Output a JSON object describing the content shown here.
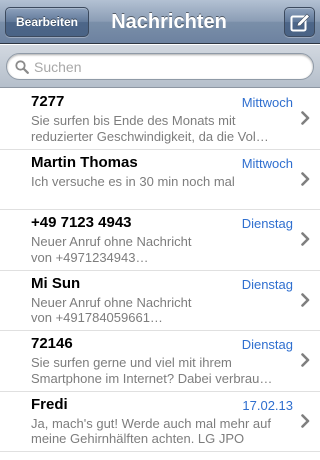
{
  "navbar": {
    "title": "Nachrichten",
    "edit_label": "Bearbeiten",
    "compose_icon": "compose-icon"
  },
  "search": {
    "placeholder": "Suchen",
    "icon": "search-icon"
  },
  "messages": [
    {
      "sender": "7277",
      "date": "Mittwoch",
      "line1": "Sie surfen bis Ende des Monats mit",
      "line2": "reduzierter Geschwindigkeit, da die Vol…"
    },
    {
      "sender": "Martin Thomas",
      "date": "Mittwoch",
      "line1": "Ich versuche es in 30 min noch mal",
      "line2": ""
    },
    {
      "sender": "+49 7123 4943",
      "date": "Dienstag",
      "line1": "Neuer Anruf ohne Nachricht",
      "line2": "von +4971234943…"
    },
    {
      "sender": "Mi Sun",
      "date": "Dienstag",
      "line1": "Neuer Anruf ohne Nachricht",
      "line2": "von +491784059661…"
    },
    {
      "sender": "72146",
      "date": "Dienstag",
      "line1": "Sie surfen gerne und viel mit ihrem",
      "line2": "Smartphone im Internet? Dabei verbrau…"
    },
    {
      "sender": "Fredi",
      "date": "17.02.13",
      "line1": "Ja, mach's gut! Werde auch mal mehr auf",
      "line2": "meine Gehirnhälften achten. LG JPO"
    }
  ],
  "colors": {
    "date_blue": "#2f6fcf",
    "preview_gray": "#7d7d7d",
    "navbar": "#7a8fa9"
  }
}
